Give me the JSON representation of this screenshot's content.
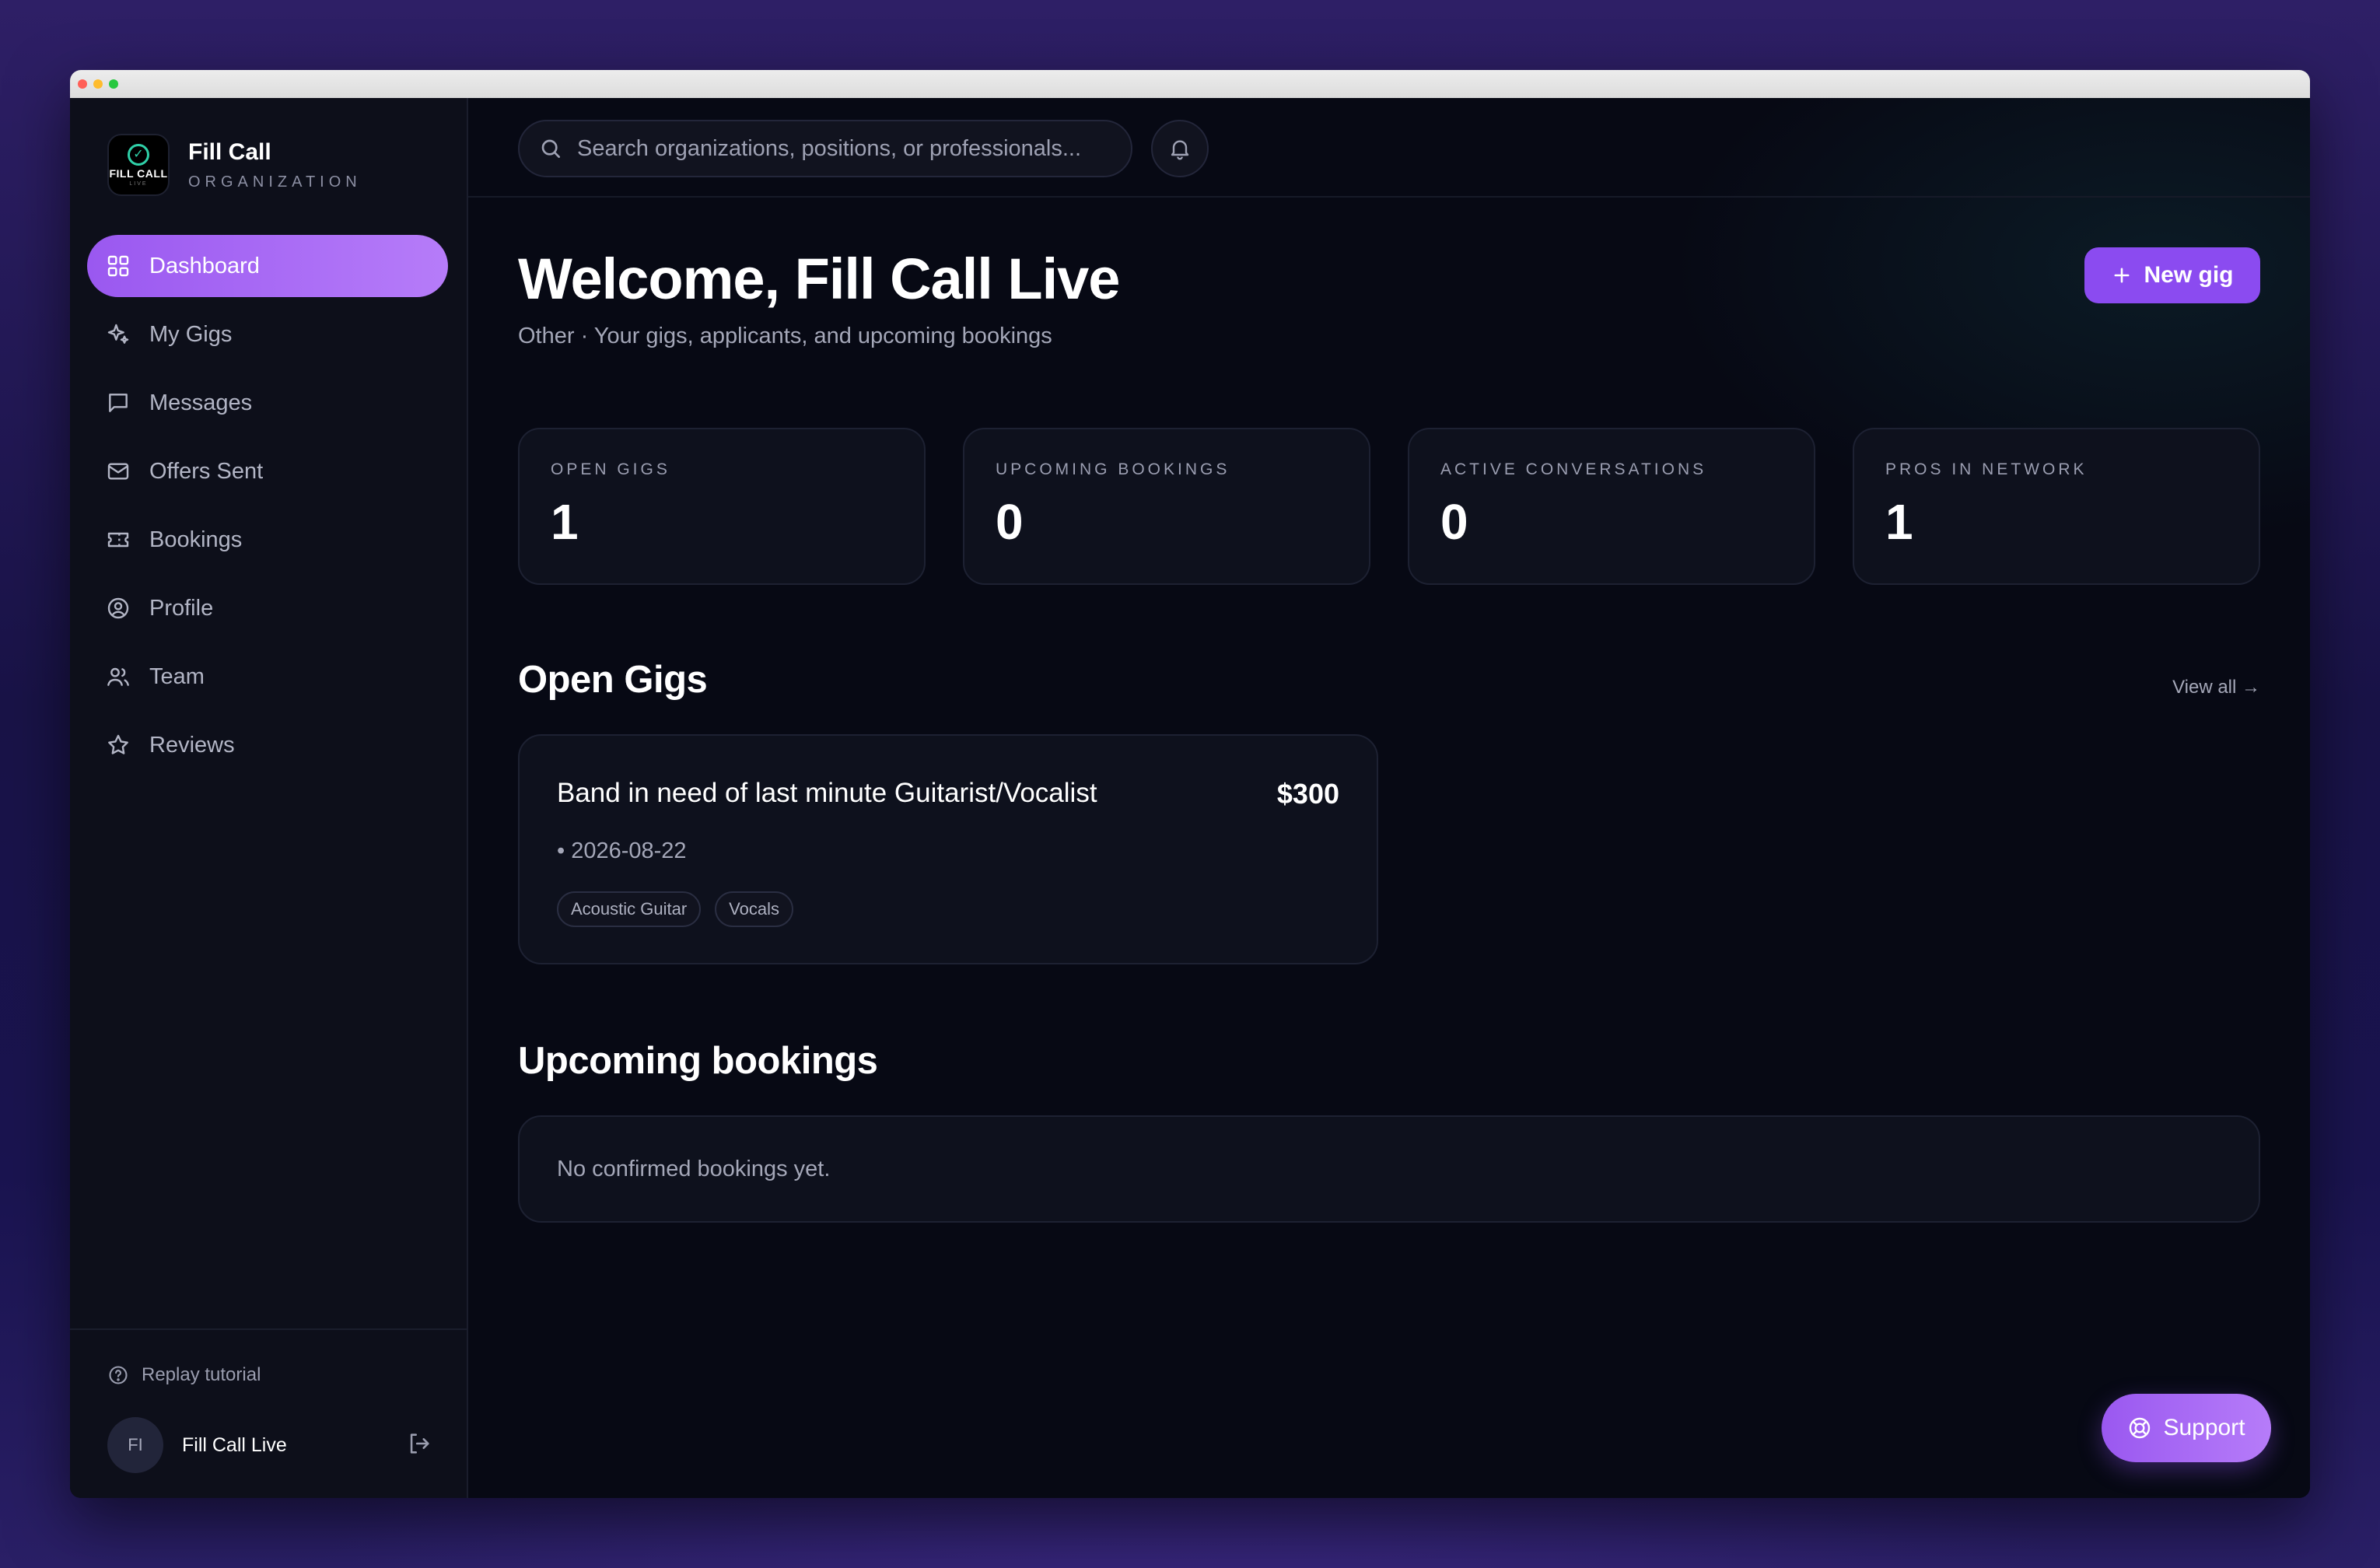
{
  "brand": {
    "name": "Fill Call",
    "tag": "ORGANIZATION",
    "logo_text": "FILL CALL",
    "logo_sub": "LIVE"
  },
  "sidebar": {
    "items": [
      {
        "label": "Dashboard",
        "icon": "grid-icon",
        "active": true
      },
      {
        "label": "My Gigs",
        "icon": "sparkles-icon"
      },
      {
        "label": "Messages",
        "icon": "message-icon"
      },
      {
        "label": "Offers Sent",
        "icon": "mail-icon"
      },
      {
        "label": "Bookings",
        "icon": "ticket-icon"
      },
      {
        "label": "Profile",
        "icon": "user-circle-icon"
      },
      {
        "label": "Team",
        "icon": "users-icon"
      },
      {
        "label": "Reviews",
        "icon": "star-icon"
      }
    ],
    "replay_label": "Replay tutorial",
    "user": {
      "initials": "FI",
      "name": "Fill Call Live"
    }
  },
  "search": {
    "placeholder": "Search organizations, positions, or professionals..."
  },
  "header": {
    "welcome": "Welcome, Fill Call Live",
    "subtitle": "Other · Your gigs, applicants, and upcoming bookings",
    "new_gig_label": "New gig"
  },
  "stats": [
    {
      "label": "OPEN GIGS",
      "value": "1"
    },
    {
      "label": "UPCOMING BOOKINGS",
      "value": "0"
    },
    {
      "label": "ACTIVE CONVERSATIONS",
      "value": "0"
    },
    {
      "label": "PROS IN NETWORK",
      "value": "1"
    }
  ],
  "open_gigs": {
    "title": "Open Gigs",
    "view_all": "View all →",
    "gig": {
      "title": "Band in need of last minute Guitarist/Vocalist",
      "price": "$300",
      "date": "• 2026-08-22",
      "tags": [
        "Acoustic Guitar",
        "Vocals"
      ]
    }
  },
  "bookings": {
    "title": "Upcoming bookings",
    "empty": "No confirmed bookings yet."
  },
  "support_label": "Support",
  "colors": {
    "accent": "#8b4bf0",
    "accent_light": "#b67cf9",
    "background": "#070914",
    "logo_check": "#2fd0a8"
  }
}
